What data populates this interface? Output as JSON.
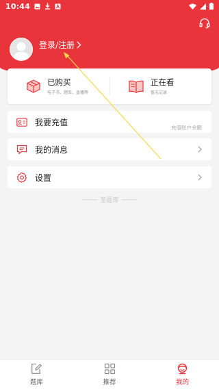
{
  "status_bar": {
    "time": "10:44"
  },
  "header": {
    "login_text": "登录/注册",
    "support_icon": "headset-icon"
  },
  "summary_card": {
    "purchased": {
      "title": "已购买",
      "subtitle": "电子书、题库、直播等",
      "icon": "package-box-icon"
    },
    "watching": {
      "title": "正在看",
      "subtitle": "暂无记录",
      "icon": "open-book-icon"
    }
  },
  "menu": {
    "recharge": {
      "label": "我要充值",
      "hint": "充值账户余额",
      "icon": "id-card-icon"
    },
    "messages": {
      "label": "我的消息",
      "icon": "message-icon"
    },
    "settings": {
      "label": "设置",
      "icon": "gear-icon"
    }
  },
  "footer_mark": "圣题库",
  "tabbar": {
    "tabs": [
      {
        "label": "题库",
        "icon": "edit-note-icon",
        "active": false
      },
      {
        "label": "推荐",
        "icon": "grid-icon",
        "active": false
      },
      {
        "label": "我的",
        "icon": "user-face-icon",
        "active": true
      }
    ]
  },
  "colors": {
    "brand_red": "#e8343a",
    "background": "#f4f4f4",
    "annotation_yellow": "#f5d84a"
  }
}
